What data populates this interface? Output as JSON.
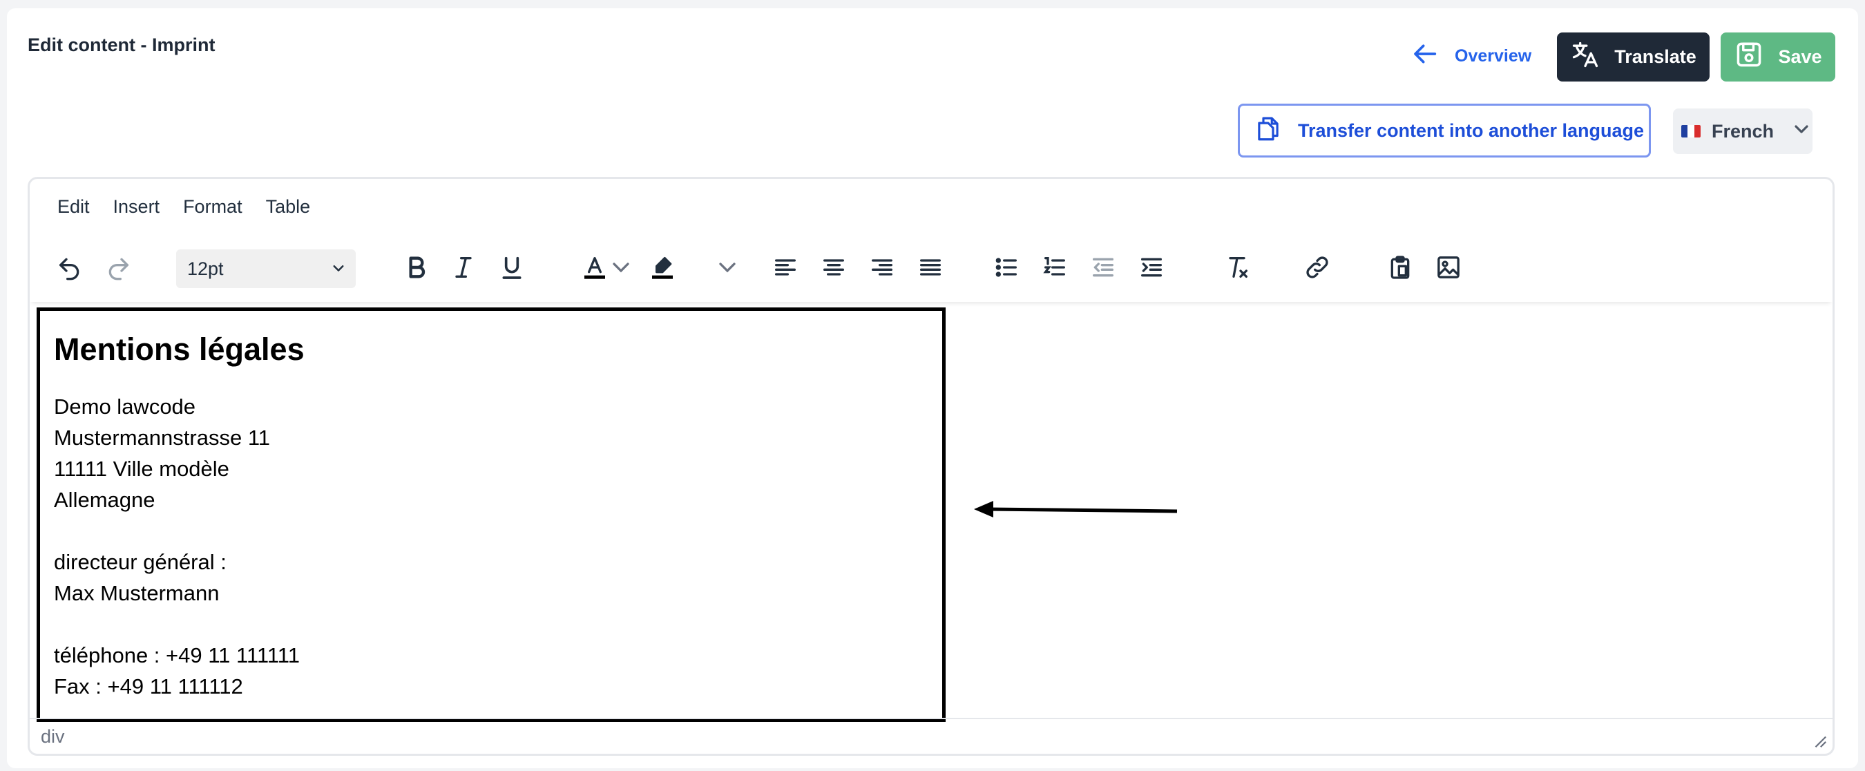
{
  "header": {
    "title": "Edit content - Imprint",
    "overview_label": "Overview",
    "translate_label": "Translate",
    "save_label": "Save"
  },
  "actions": {
    "transfer_label": "Transfer content into another language",
    "language": "French"
  },
  "editor": {
    "menu": [
      "Edit",
      "Insert",
      "Format",
      "Table"
    ],
    "font_size": "12pt",
    "status_path": "div"
  },
  "content": {
    "heading": "Mentions légales",
    "company": "Demo lawcode",
    "street": "Mustermannstrasse 11",
    "city": "11111 Ville modèle",
    "country": "Allemagne",
    "director_label": "directeur général :",
    "director_name": "Max Mustermann",
    "phone": "téléphone : +49 11 111111",
    "fax": "Fax : +49 11 111112"
  },
  "colors": {
    "primary_blue": "#2563eb",
    "translate_bg": "#1f2937",
    "save_bg": "#5eb984",
    "transfer_border": "#7c96f0"
  },
  "icons": {
    "overview": "arrow-left-icon",
    "translate": "translate-icon",
    "save": "save-icon",
    "transfer": "copy-documents-icon",
    "language_flag": "flag-fr-icon"
  }
}
